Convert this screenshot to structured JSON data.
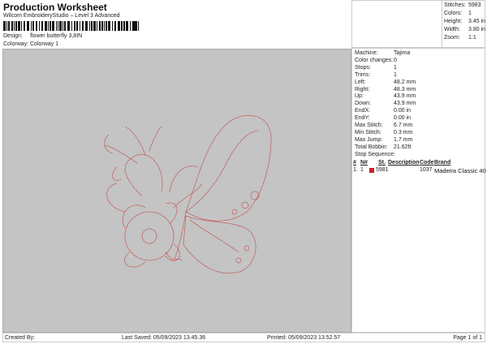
{
  "header": {
    "title": "Production Worksheet",
    "subtitle": "Wilcom EmbroideryStudio – Level 3 Advanced",
    "barcode_suffix": ","
  },
  "design": {
    "label": "Design:",
    "value": "flower butterfly 3,8IN"
  },
  "colorway": {
    "label": "Colorway:",
    "value": "Colorway 1"
  },
  "summary": [
    {
      "label": "Stitches:",
      "value": "5983"
    },
    {
      "label": "Colors:",
      "value": "1"
    },
    {
      "label": "Height:",
      "value": "3.45 in"
    },
    {
      "label": "Width:",
      "value": "3.80 in"
    },
    {
      "label": "Zoom:",
      "value": "1:1"
    }
  ],
  "details": [
    {
      "label": "Machine:",
      "value": "Tajima"
    },
    {
      "label": "Color changes:",
      "value": "0"
    },
    {
      "label": "Stops:",
      "value": "1"
    },
    {
      "label": "Trims:",
      "value": "1"
    },
    {
      "label": "Left:",
      "value": "48.2 mm"
    },
    {
      "label": "Right:",
      "value": "48.3 mm"
    },
    {
      "label": "Up:",
      "value": "43.9 mm"
    },
    {
      "label": "Down:",
      "value": "43.9 mm"
    },
    {
      "label": "EndX:",
      "value": "0.00 in"
    },
    {
      "label": "EndY:",
      "value": "0.00 in"
    },
    {
      "label": "Max Stitch:",
      "value": "6.7 mm"
    },
    {
      "label": "Min Stitch:",
      "value": "0.3 mm"
    },
    {
      "label": "Max Jump:",
      "value": "1.7 mm"
    },
    {
      "label": "Total Bobbin:",
      "value": "21.62ft"
    }
  ],
  "stop_sequence": {
    "title": "Stop Sequence:",
    "headers": [
      "#",
      "N#",
      "St.",
      "Description",
      "Code",
      "Brand"
    ],
    "rows": [
      {
        "num": "1.",
        "n": "1",
        "color": "#c8202a",
        "st": "5981",
        "description": "",
        "code": "1037",
        "brand": "Madeira Classic 40"
      }
    ]
  },
  "design_color": "#c0393b",
  "footer": {
    "created": "Created By:",
    "saved": "Last Saved: 05/09/2023 13.45.36",
    "printed": "Printed: 05/09/2023 13.52.57",
    "page": "Page 1 of 1"
  }
}
